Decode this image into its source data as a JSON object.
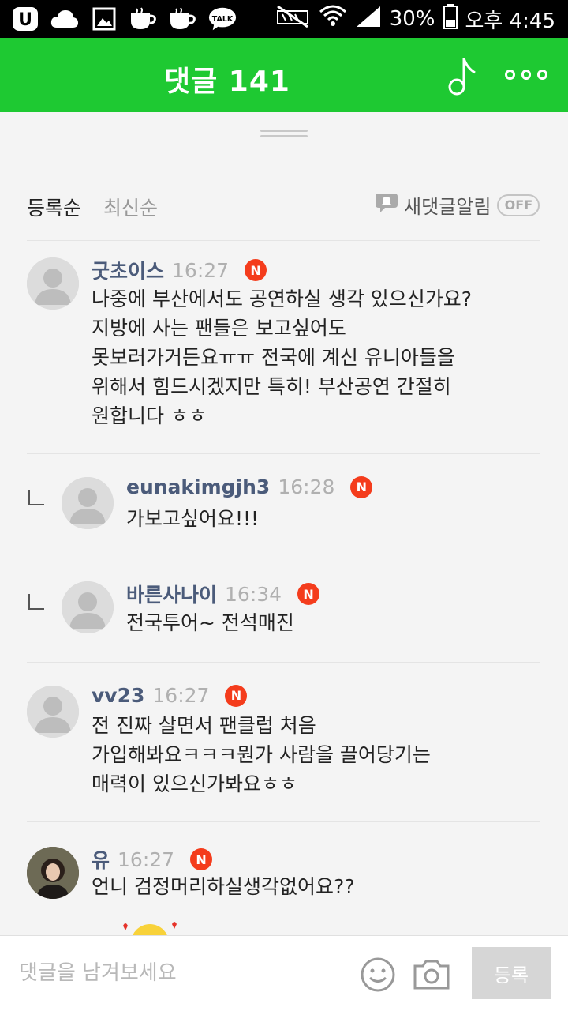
{
  "status_bar": {
    "battery_percent": "30%",
    "time": "오후 4:45",
    "left_icons": [
      "uplus-icon",
      "cloud-icon",
      "gallery-icon",
      "cup-icon",
      "cup-icon",
      "kakaotalk-icon"
    ],
    "talk_icon_text": "TALK"
  },
  "header": {
    "title": "댓글 141",
    "bg_color": "#1ec932"
  },
  "sort": {
    "active_label": "등록순",
    "inactive_label": "최신순",
    "alarm_label": "새댓글알림",
    "alarm_state": "OFF"
  },
  "comments": [
    {
      "author": "굿초이스",
      "time": "16:27",
      "badge": "N",
      "lines": [
        "나중에 부산에서도 공연하실 생각 있으신가요?",
        "지방에 사는 팬들은 보고싶어도",
        "못보러가거든요ㅠㅠ 전국에 계신 유니아들을",
        "위해서 힘드시겠지만 특히! 부산공연 간절히",
        "원합니다 ㅎㅎ"
      ]
    },
    {
      "author": "eunakimgjh3",
      "time": "16:28",
      "badge": "N",
      "lines": [
        "가보고싶어요!!!"
      ]
    },
    {
      "author": "바른사나이",
      "time": "16:34",
      "badge": "N",
      "lines": [
        "전국투어~ 전석매진"
      ]
    },
    {
      "author": "vv23",
      "time": "16:27",
      "badge": "N",
      "lines": [
        "전 진짜 살면서 팬클럽 처음",
        "가입해봐요ㅋㅋㅋ뭔가 사람을 끌어당기는",
        "매력이 있으신가봐요ㅎㅎ"
      ]
    },
    {
      "author": "유",
      "time": "16:27",
      "badge": "N",
      "lines": [
        "언니 검정머리하실생각없어요??"
      ]
    }
  ],
  "input": {
    "placeholder": "댓글을 남겨보세요",
    "submit_label": "등록"
  },
  "colors": {
    "accent_green": "#1ec932",
    "badge_red": "#f43c1c",
    "author_blue": "#4b5b7a"
  }
}
